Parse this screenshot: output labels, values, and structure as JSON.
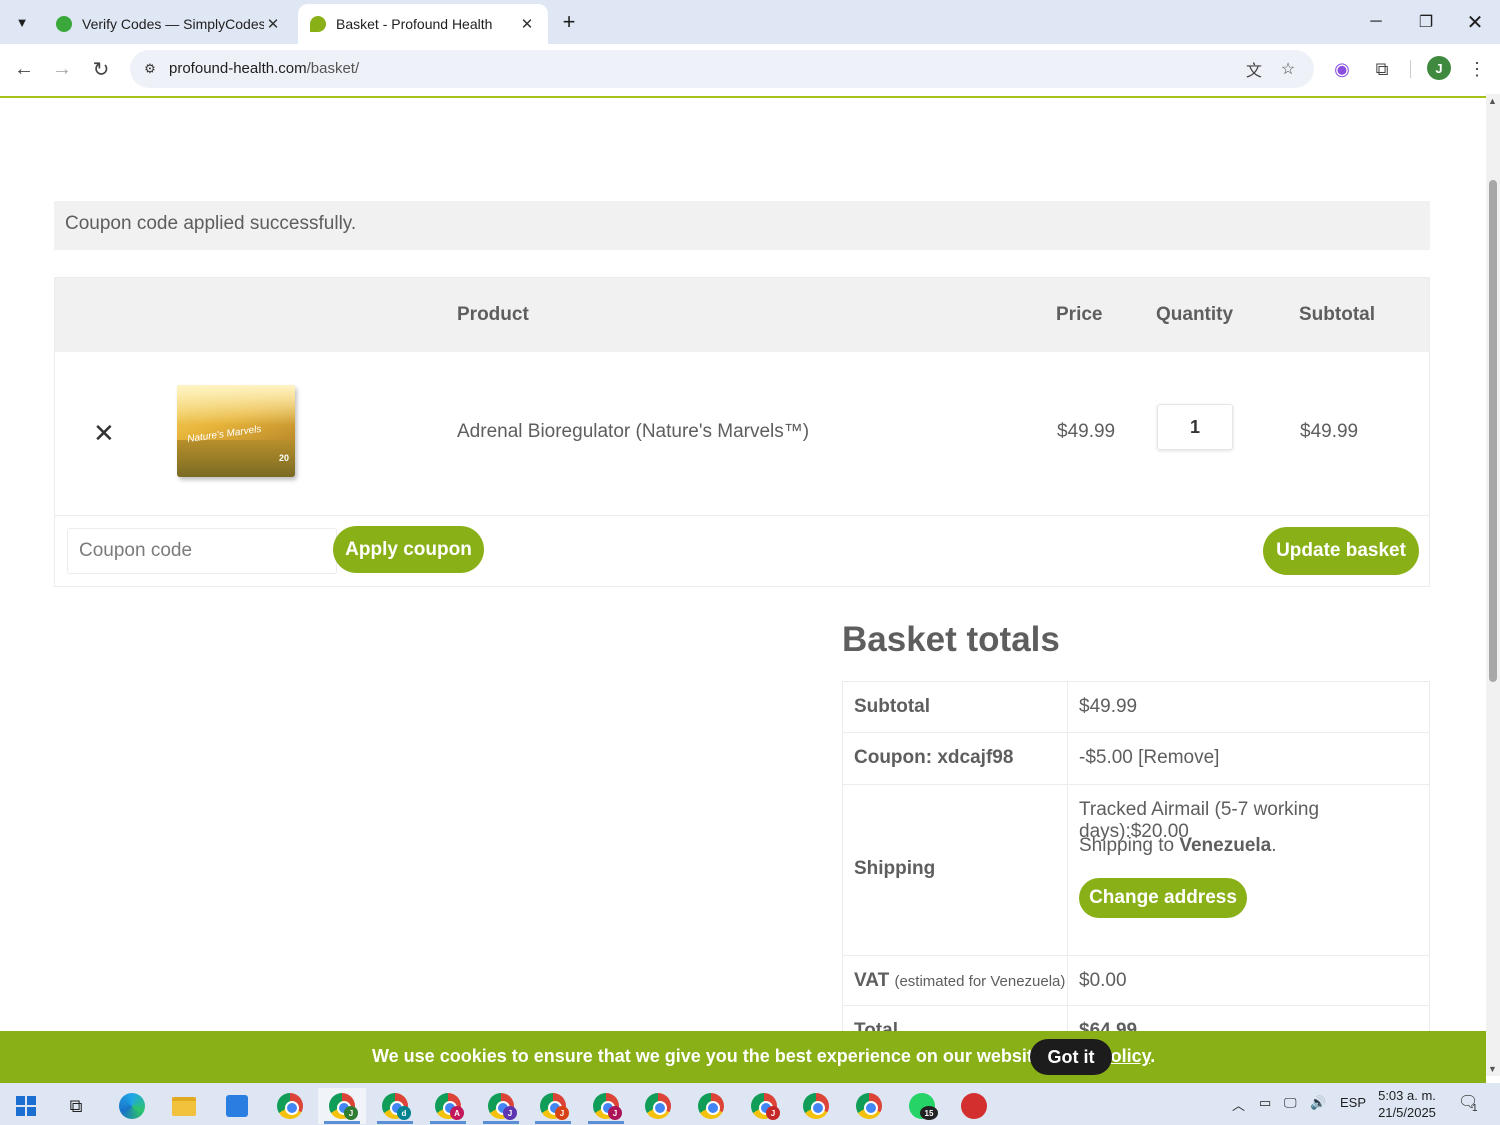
{
  "browser": {
    "tabs": [
      {
        "title": "Verify Codes — SimplyCodes",
        "favicon_color": "#3aa83a",
        "active": false
      },
      {
        "title": "Basket - Profound Health",
        "favicon_color": "#8ab018",
        "active": true
      }
    ],
    "url_domain": "profound-health.com",
    "url_path": "/basket/",
    "profile_initial": "J"
  },
  "notice": {
    "message": "Coupon code applied successfully."
  },
  "cart": {
    "headers": {
      "product": "Product",
      "price": "Price",
      "quantity": "Quantity",
      "subtotal": "Subtotal"
    },
    "items": [
      {
        "name": "Adrenal Bioregulator (Nature's Marvels™)",
        "image_label": "Nature's Marvels",
        "image_number": "20",
        "price": "$49.99",
        "quantity": "1",
        "subtotal": "$49.99"
      }
    ],
    "coupon_placeholder": "Coupon code",
    "apply_coupon_label": "Apply coupon",
    "update_basket_label": "Update basket"
  },
  "totals": {
    "title": "Basket totals",
    "subtotal_label": "Subtotal",
    "subtotal_value": "$49.99",
    "coupon_label": "Coupon: xdcajf98",
    "coupon_value": "-$5.00",
    "coupon_remove": "[Remove]",
    "shipping_label": "Shipping",
    "shipping_method": "Tracked Airmail (5-7 working days):$20.00",
    "shipping_to_prefix": "Shipping to",
    "shipping_country": "Venezuela",
    "change_address_label": "Change address",
    "vat_label": "VAT",
    "vat_note": "(estimated for Venezuela)",
    "vat_value": "$0.00",
    "total_label": "Total",
    "total_value": "$64.99"
  },
  "cookie": {
    "message": "We use cookies to ensure that we give you the best experience on our website.",
    "policy_link": "View Policy",
    "got_it_label": "Got it"
  },
  "taskbar": {
    "language": "ESP",
    "time": "5:03 a. m.",
    "date": "21/5/2025",
    "whatsapp_badge": "15",
    "notifications_count": "1",
    "chrome_profile_badges": [
      "J",
      "d",
      "A",
      "J",
      "J",
      "J",
      "",
      "",
      "J",
      "D",
      ""
    ]
  },
  "colors": {
    "accent": "#8ab018",
    "text": "#5e5e5e"
  }
}
